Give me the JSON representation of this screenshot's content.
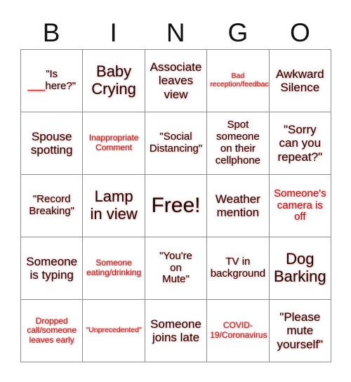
{
  "card": {
    "title": "BINGO",
    "header_letters": [
      "B",
      "I",
      "N",
      "G",
      "O"
    ],
    "background_color": "#ffffff",
    "grid_line_color": "#8c8c8c",
    "text_colors": {
      "black": "#0d0d0d",
      "red": "#a52121",
      "glow": "#ffa0a0"
    },
    "rows": 5,
    "columns": 5,
    "free_space": {
      "row": 3,
      "column": 3,
      "label": "Free!"
    }
  },
  "squares": [
    {
      "id": "r1c1",
      "text": "\"Is\n___here?\"",
      "color": "black",
      "size": "sm",
      "has_blank_rule": true
    },
    {
      "id": "r1c2",
      "text": "Baby\nCrying",
      "color": "black",
      "size": "lg"
    },
    {
      "id": "r1c3",
      "text": "Associate\nleaves\nview",
      "color": "black",
      "size": "md"
    },
    {
      "id": "r1c4",
      "text": "Bad\nreception/feedback",
      "color": "red",
      "size": "xxs"
    },
    {
      "id": "r1c5",
      "text": "Awkward\nSilence",
      "color": "black",
      "size": "md"
    },
    {
      "id": "r2c1",
      "text": "Spouse\nspotting",
      "color": "black",
      "size": "md"
    },
    {
      "id": "r2c2",
      "text": "Inappropriate\nComment",
      "color": "red",
      "size": "xs"
    },
    {
      "id": "r2c3",
      "text": "\"Social\nDistancing\"",
      "color": "black",
      "size": "sm"
    },
    {
      "id": "r2c4",
      "text": "Spot\nsomeone\non their\ncellphone",
      "color": "black",
      "size": "sm"
    },
    {
      "id": "r2c5",
      "text": "\"Sorry\ncan you\nrepeat?\"",
      "color": "black",
      "size": "md"
    },
    {
      "id": "r3c1",
      "text": "\"Record\nBreaking\"",
      "color": "black",
      "size": "sm"
    },
    {
      "id": "r3c2",
      "text": "Lamp\nin view",
      "color": "black",
      "size": "lg"
    },
    {
      "id": "r3c3",
      "text": "Free!",
      "color": "black",
      "size": "xl"
    },
    {
      "id": "r3c4",
      "text": "Weather\nmention",
      "color": "black",
      "size": "md"
    },
    {
      "id": "r3c5",
      "text": "Someone's\ncamera is\noff",
      "color": "red",
      "size": "sm"
    },
    {
      "id": "r4c1",
      "text": "Someone\nis typing",
      "color": "black",
      "size": "md"
    },
    {
      "id": "r4c2",
      "text": "Someone\neating/drinking",
      "color": "red",
      "size": "xs"
    },
    {
      "id": "r4c3",
      "text": "\"You're\non\nMute\"",
      "color": "black",
      "size": "sm"
    },
    {
      "id": "r4c4",
      "text": "TV in\nbackground",
      "color": "black",
      "size": "sm"
    },
    {
      "id": "r4c5",
      "text": "Dog\nBarking",
      "color": "black",
      "size": "lg"
    },
    {
      "id": "r5c1",
      "text": "Dropped\ncall/someone\nleaves early",
      "color": "red",
      "size": "xs"
    },
    {
      "id": "r5c2",
      "text": "\"Unprecedented\"",
      "color": "red",
      "size": "xxs"
    },
    {
      "id": "r5c3",
      "text": "Someone\njoins late",
      "color": "black",
      "size": "md"
    },
    {
      "id": "r5c4",
      "text": "COVID-\n19/Coronavirus",
      "color": "red",
      "size": "xs"
    },
    {
      "id": "r5c5",
      "text": "\"Please\nmute\nyourself\"",
      "color": "black",
      "size": "md"
    }
  ]
}
